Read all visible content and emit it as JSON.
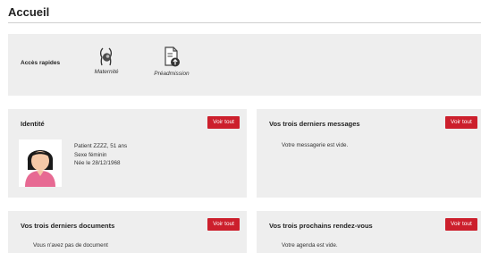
{
  "page": {
    "title": "Accueil"
  },
  "quick_access": {
    "label": "Accès rapides",
    "items": [
      {
        "label": "Maternité",
        "icon": "pregnancy-icon"
      },
      {
        "label": "Préadmission",
        "icon": "document-upload-icon"
      }
    ]
  },
  "identity": {
    "title": "Identité",
    "button": "Voir tout",
    "patient": "Patient ZZZZ, 51 ans",
    "sex": "Sexe féminin",
    "birth": "Née le 28/12/1968"
  },
  "messages": {
    "title": "Vos trois derniers messages",
    "button": "Voir tout",
    "empty": "Votre messagerie est vide."
  },
  "documents": {
    "title": "Vos trois derniers documents",
    "button": "Voir tout",
    "empty": "Vous n'avez pas de document"
  },
  "appointments": {
    "title": "Vos trois prochains rendez-vous",
    "button": "Voir tout",
    "empty": "Votre agenda est vide."
  },
  "colors": {
    "accent": "#cc1f2c",
    "panel": "#eeeeee",
    "avatar_shirt": "#e76a93"
  }
}
